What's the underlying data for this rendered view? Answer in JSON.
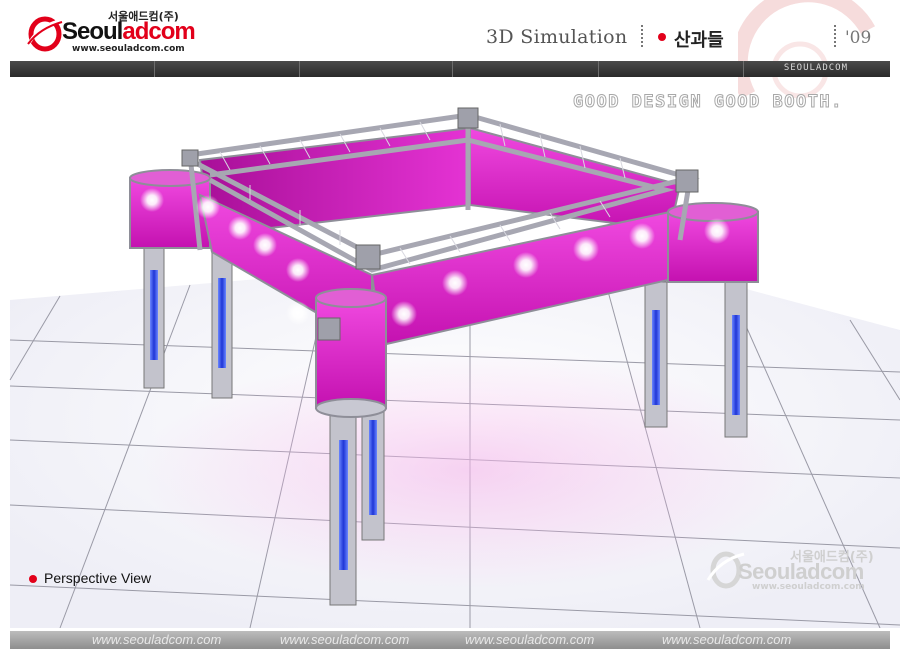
{
  "header": {
    "logo_korean": "서울애드컴(주)",
    "logo_name_prefix": "Seoul",
    "logo_name_suffix": "adcom",
    "logo_url": "www.seouladcom.com",
    "title": "3D Simulation",
    "project_name": "산과들",
    "year": "'09"
  },
  "navbar": {
    "brand": "SEOULADCOM"
  },
  "tagline": "GOOD DESIGN GOOD BOOTH.",
  "view": {
    "label": "Perspective View"
  },
  "watermark": {
    "korean": "서울애드컴(주)",
    "name": "Seouladcom",
    "url": "www.seouladcom.com"
  },
  "footer": {
    "urls": [
      "www.seouladcom.com",
      "www.seouladcom.com",
      "www.seouladcom.com",
      "www.seouladcom.com"
    ]
  },
  "colors": {
    "brand_red": "#e2001a",
    "banner_magenta": "#d81fc4",
    "truss_silver": "#b9b9c2",
    "column_blue": "#2f4fe0"
  },
  "icons": [
    "logo-swoosh-icon",
    "red-bullet-icon",
    "watermark-swoosh-icon"
  ]
}
